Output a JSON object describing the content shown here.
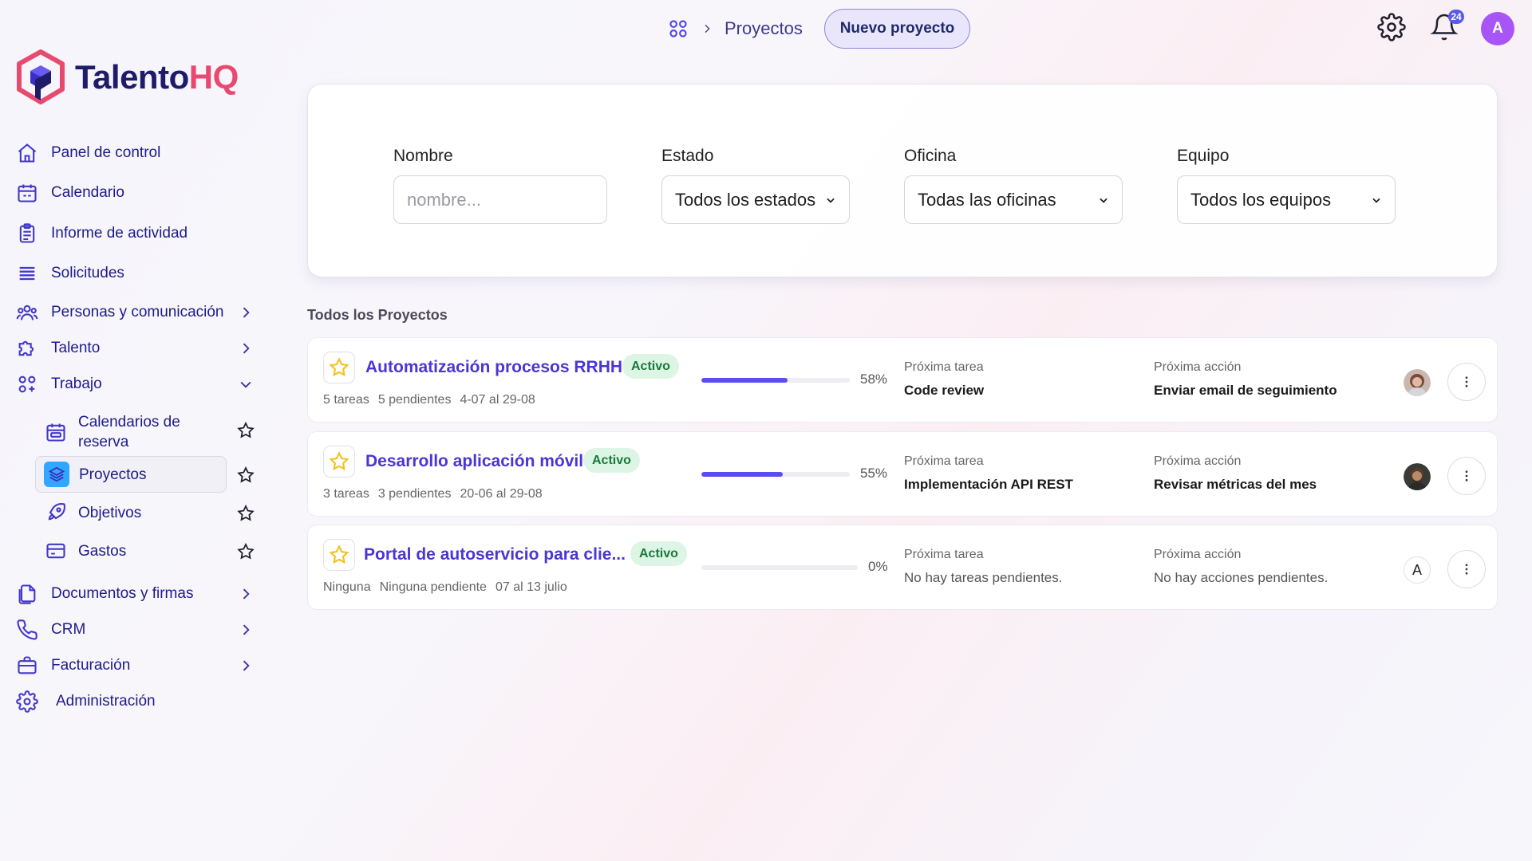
{
  "header": {
    "breadcrumb_icon": "grid-apps-icon",
    "breadcrumb": "Proyectos",
    "new_project_label": "Nuevo proyecto",
    "notification_count": "24",
    "user_initial": "A"
  },
  "brand": {
    "part1": "Talento",
    "part2": "HQ",
    "color1": "#1e1b6b",
    "color2": "#e84a6f"
  },
  "sidebar": {
    "items": [
      {
        "label": "Panel de control",
        "icon": "home-icon"
      },
      {
        "label": "Calendario",
        "icon": "calendar-icon"
      },
      {
        "label": "Informe de actividad",
        "icon": "clipboard-icon"
      },
      {
        "label": "Solicitudes",
        "icon": "list-icon"
      },
      {
        "label": "Personas y comunicación",
        "icon": "people-icon"
      },
      {
        "label": "Talento",
        "icon": "puzzle-icon"
      },
      {
        "label": "Trabajo",
        "icon": "grid-icon"
      },
      {
        "label": "Documentos y firmas",
        "icon": "documents-icon"
      },
      {
        "label": "CRM",
        "icon": "phone-icon"
      },
      {
        "label": "Facturación",
        "icon": "briefcase-icon"
      },
      {
        "label": "Administración",
        "icon": "gear-icon"
      }
    ],
    "sub_items": [
      {
        "label": "Calendarios de reserva",
        "icon": "calendar-booking-icon"
      },
      {
        "label": "Proyectos",
        "icon": "layers-icon"
      },
      {
        "label": "Objetivos",
        "icon": "rocket-icon"
      },
      {
        "label": "Gastos",
        "icon": "credit-card-icon"
      }
    ]
  },
  "filters": {
    "name_label": "Nombre",
    "name_placeholder": "nombre...",
    "status_label": "Estado",
    "status_value": "Todos los estados",
    "office_label": "Oficina",
    "office_value": "Todas las oficinas",
    "team_label": "Equipo",
    "team_value": "Todos los equipos"
  },
  "projects_title": "Todos los Proyectos",
  "projects": [
    {
      "title": "Automatización procesos RRHH",
      "status": "Activo",
      "tasks": "5 tareas",
      "pending": "5 pendientes",
      "dates": "4-07 al 29-08",
      "progress": 0.58,
      "progress_label": "58%",
      "next_task_label": "Próxima tarea",
      "next_task": "Code review",
      "next_action_label": "Próxima acción",
      "next_action": "Enviar email de seguimiento",
      "avatar": "photo"
    },
    {
      "title": "Desarrollo aplicación móvil",
      "status": "Activo",
      "tasks": "3 tareas",
      "pending": "3 pendientes",
      "dates": "20-06 al 29-08",
      "progress": 0.55,
      "progress_label": "55%",
      "next_task_label": "Próxima tarea",
      "next_task": "Implementación API REST",
      "next_action_label": "Próxima acción",
      "next_action": "Revisar métricas del mes",
      "avatar": "photo"
    },
    {
      "title": "Portal de autoservicio para clie...",
      "status": "Activo",
      "tasks": "Ninguna",
      "pending": "Ninguna pendiente",
      "dates": "07 al 13 julio",
      "progress": 0,
      "progress_label": "0%",
      "next_task_label": "Próxima tarea",
      "next_task": "No hay tareas pendientes.",
      "next_action_label": "Próxima acción",
      "next_action": "No hay acciones pendientes.",
      "avatar_letter": "A"
    }
  ]
}
